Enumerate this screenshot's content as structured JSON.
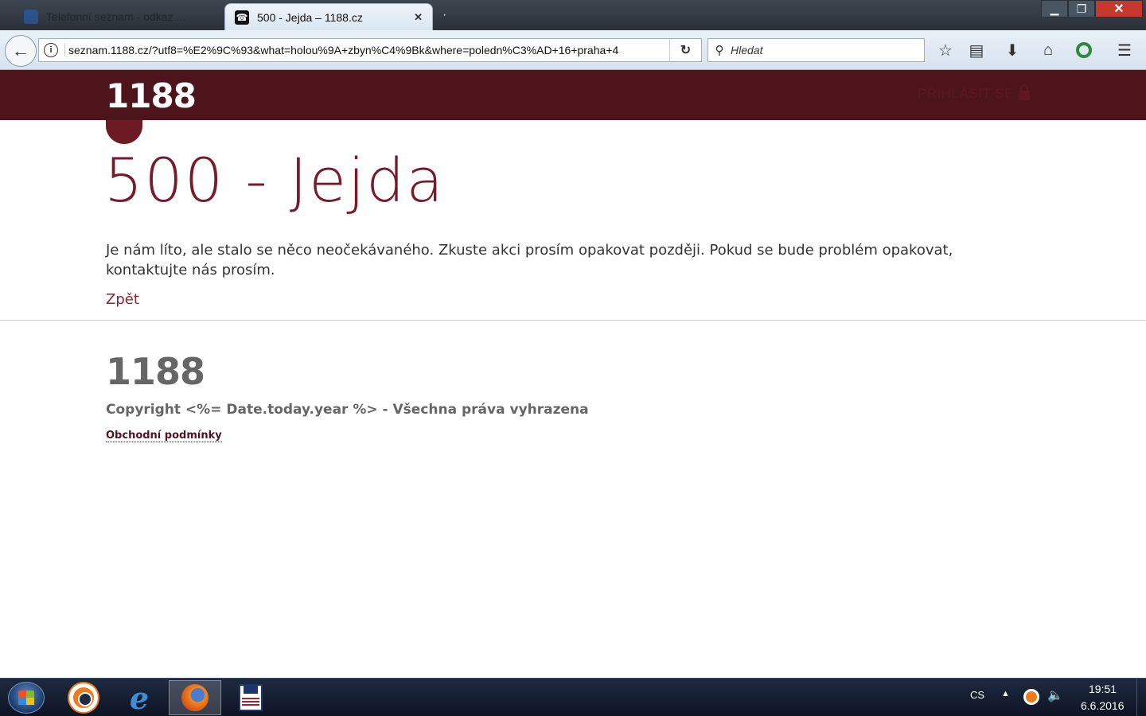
{
  "browser": {
    "tabs": [
      {
        "title": "Telefonní seznam - odkaz ...",
        "active": false
      },
      {
        "title": "500 - Jejda – 1188.cz",
        "active": true
      }
    ],
    "url": "seznam.1188.cz/?utf8=%E2%9C%93&what=holou%9A+zbyn%C4%9Bk&where=poledn%C3%AD+16+praha+4",
    "search_placeholder": "Hledat"
  },
  "site": {
    "logo": "1188",
    "login_label": "PŘIHLÁSIT SE",
    "error_title": "500 - Jejda",
    "error_message": "Je nám líto, ale stalo se něco neočekávaného. Zkuste akci prosím opakovat později. Pokud se bude problém opakovat, kontaktujte nás prosím.",
    "back_link": "Zpět",
    "footer": {
      "logo": "1188",
      "copyright": "Copyright <%= Date.today.year %> - Všechna práva vyhrazena",
      "terms_link": "Obchodní podmínky"
    },
    "colors": {
      "header_bg": "#4d141c",
      "accent": "#7a1a28"
    }
  },
  "taskbar": {
    "language": "CS",
    "time": "19:51",
    "date": "6.6.2016"
  }
}
